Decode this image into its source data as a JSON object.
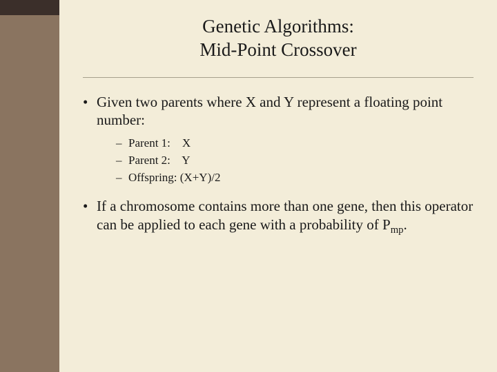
{
  "title": {
    "line1": "Genetic Algorithms:",
    "line2": "Mid-Point Crossover"
  },
  "bullets": {
    "b1_mark": "•",
    "b1_text": "Given two parents where X and Y represent a floating point number:",
    "sub_mark": "–",
    "sub1": "Parent 1:    X",
    "sub2": "Parent 2:    Y",
    "sub3": "Offspring: (X+Y)/2",
    "b2_mark": "•",
    "b2_text_pre": "If a chromosome contains more than one gene, then this operator can be applied to each gene with a probability of P",
    "b2_sub": "mp",
    "b2_text_post": "."
  }
}
